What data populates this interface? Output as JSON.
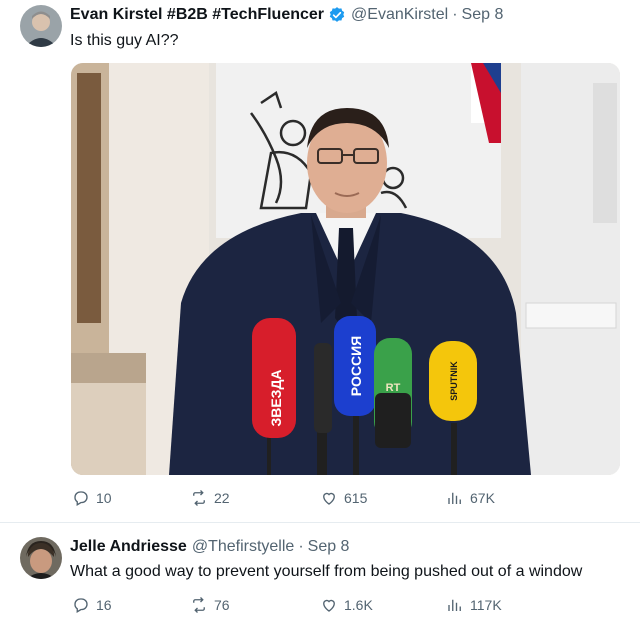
{
  "tweets": [
    {
      "author_name": "Evan Kirstel #B2B #TechFluencer",
      "handle": "@EvanKirstel",
      "date": "Sep 8",
      "text": "Is this guy AI??",
      "verified": true,
      "media": {
        "microphone_labels": [
          "ЗВЕЗДА",
          "РОССИЯ",
          "RT",
          "SPUTNIK"
        ]
      },
      "stats": {
        "replies": "10",
        "reposts": "22",
        "likes": "615",
        "views": "67K"
      }
    },
    {
      "author_name": "Jelle Andriesse",
      "handle": "@Thefirstyelle",
      "date": "Sep 8",
      "text": "What a good way to prevent yourself from being pushed out of a window",
      "verified": false,
      "stats": {
        "replies": "16",
        "reposts": "76",
        "likes": "1.6K",
        "views": "117K"
      }
    }
  ],
  "separator": "·",
  "icons": {
    "reply": "reply-icon",
    "repost": "repost-icon",
    "like": "like-icon",
    "views": "views-icon",
    "verified": "verified-badge-icon"
  },
  "colors": {
    "verified_blue": "#1d9bf0",
    "secondary_text": "#536471"
  }
}
